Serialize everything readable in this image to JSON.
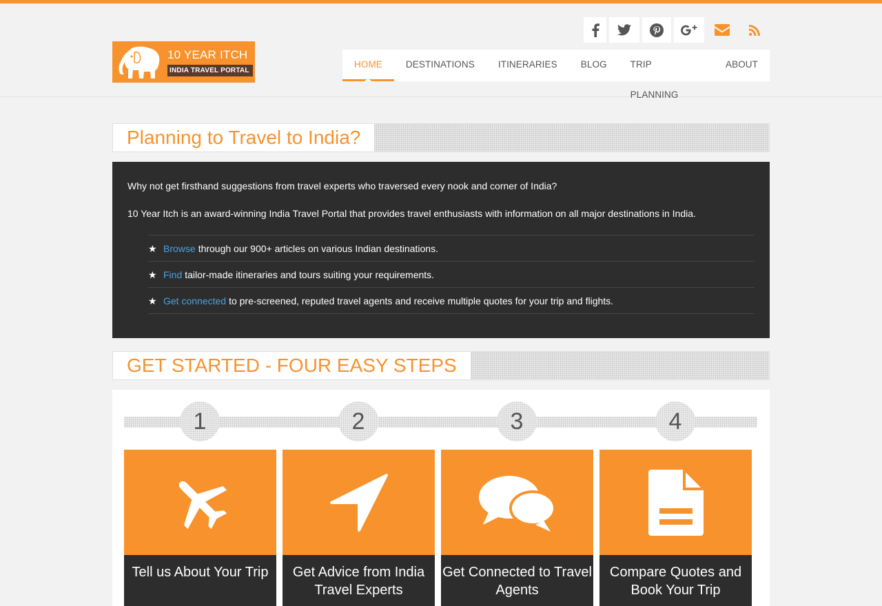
{
  "brand": {
    "line1": "10 YEAR ITCH",
    "line2": "INDIA TRAVEL PORTAL"
  },
  "social": [
    "facebook-icon",
    "twitter-icon",
    "pinterest-icon",
    "google-plus-icon",
    "email-icon",
    "rss-icon"
  ],
  "nav": {
    "items": [
      "HOME",
      "DESTINATIONS",
      "ITINERARIES",
      "BLOG",
      "TRIP PLANNING",
      "ABOUT"
    ],
    "active": "HOME"
  },
  "intro": {
    "title": "Planning to Travel to India?",
    "p1": "Why not get firsthand suggestions from travel experts who traversed every nook and corner of India?",
    "p2": "10 Year Itch is an award-winning India Travel Portal that provides travel enthusiasts with information on all major destinations in India.",
    "bullets": [
      {
        "link": "Browse",
        "text": "through our 900+ articles on various Indian destinations."
      },
      {
        "link": "Find",
        "text": "tailor-made itineraries and tours suiting your requirements."
      },
      {
        "link": "Get connected",
        "text": "to pre-screened, reputed travel agents and receive multiple quotes for your trip and flights."
      }
    ]
  },
  "steps": {
    "title": "GET STARTED - FOUR EASY STEPS",
    "items": [
      {
        "num": "1",
        "icon": "plane-icon",
        "caption": "Tell us About Your Trip"
      },
      {
        "num": "2",
        "icon": "location-arrow-icon",
        "caption": "Get Advice from India Travel Experts"
      },
      {
        "num": "3",
        "icon": "chat-bubbles-icon",
        "caption": "Get Connected to Travel Agents"
      },
      {
        "num": "4",
        "icon": "document-icon",
        "caption": "Compare Quotes and Book Your Trip"
      }
    ]
  },
  "colors": {
    "accent": "#f8922c",
    "dark": "#2d2d2d",
    "link": "#4aa3df"
  }
}
